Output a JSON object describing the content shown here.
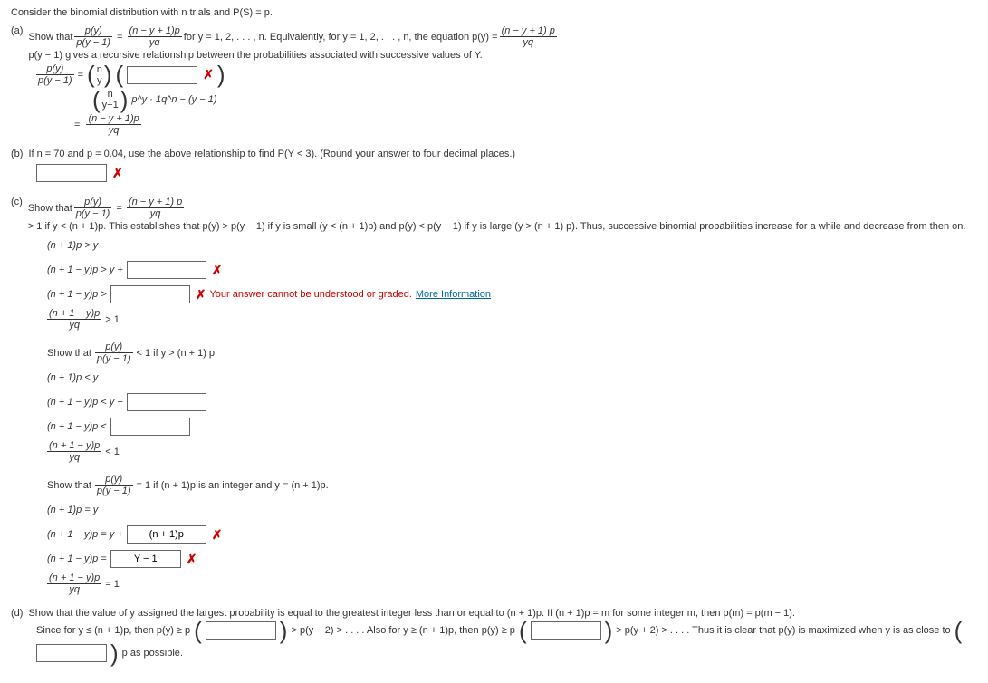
{
  "intro": "Consider the binomial distribution with n trials and P(S) = p.",
  "a": {
    "prefix": "(a)",
    "text1": "Show that ",
    "text2": " for y = 1, 2, . . . , n. Equivalently, for y = 1, 2, . . . , n, the equation p(y) = ",
    "text3": " p(y − 1) gives a recursive relationship between the probabilities associated with successive values of Y.",
    "frac1_num": "p(y)",
    "frac1_den": "p(y − 1)",
    "frac2_num": "(n − y + 1)p",
    "frac2_den": "yq",
    "frac3_num": "(n − y + 1) p",
    "frac3_den": "yq",
    "step2_a": "p^y · 1q^n − (y − 1)",
    "binom_top": "n",
    "binom_bot": "y",
    "step3_num": "(n − y + 1)p",
    "step3_den": "yq"
  },
  "b": {
    "prefix": "(b)",
    "text": "If n = 70 and p = 0.04, use the above relationship to find P(Y < 3). (Round your answer to four decimal places.)"
  },
  "c": {
    "prefix": "(c)",
    "show1": "Show that ",
    "cond1": " > 1 if y < (n + 1)p. This establishes that p(y) > p(y − 1) if y is small (y < (n + 1)p) and p(y) < p(y − 1) if y is large (y > (n + 1) p). Thus, successive binomial probabilities increase for a while and decrease from then on.",
    "f_num": "p(y)",
    "f_den": "p(y − 1)",
    "f2_num": "(n − y + 1) p",
    "f2_den": "yq",
    "line1": "(n + 1)p  >  y",
    "line2": "(n + 1 − y)p  >  y + ",
    "line3": "(n + 1 − y)p  > ",
    "err": "Your answer cannot be understood or graded. ",
    "more": "More Information",
    "line4_lhs_num": "(n + 1 − y)p",
    "line4_lhs_den": "yq",
    "gt1": "  >  1",
    "show2": "Show that ",
    "show2_cond": " < 1 if y > (n + 1) p.",
    "line5": "(n + 1)p  <  y",
    "line6": "(n + 1 − y)p  <  y − ",
    "line7": "(n + 1 − y)p  < ",
    "lt1": "  <  1",
    "show3": "Show that ",
    "show3_cond": " = 1 if (n + 1)p is an integer and y = (n + 1)p.",
    "line8": "(n + 1)p  =  y",
    "line9": "(n + 1 − y)p  =  y + ",
    "line9_ans": "(n + 1)p",
    "line10": "(n + 1 − y)p  = ",
    "line10_ans": "Y − 1",
    "eq1": "  =  1"
  },
  "d": {
    "prefix": "(d)",
    "text1": "Show that the value of y assigned the largest probability is equal to the greatest integer less than or equal to (n + 1)p. If (n + 1)p = m for some integer m, then p(m) = p(m − 1).",
    "text2": "Since for y ≤ (n + 1)p, then p(y) ≥ p",
    "text3": " > p(y − 2) > . . . . Also for y ≥ (n + 1)p, then p(y) ≥ p",
    "text4": " > p(y + 2) > . . . . Thus it is clear that p(y) is maximized when y is as close to ",
    "text5": "p as possible."
  }
}
